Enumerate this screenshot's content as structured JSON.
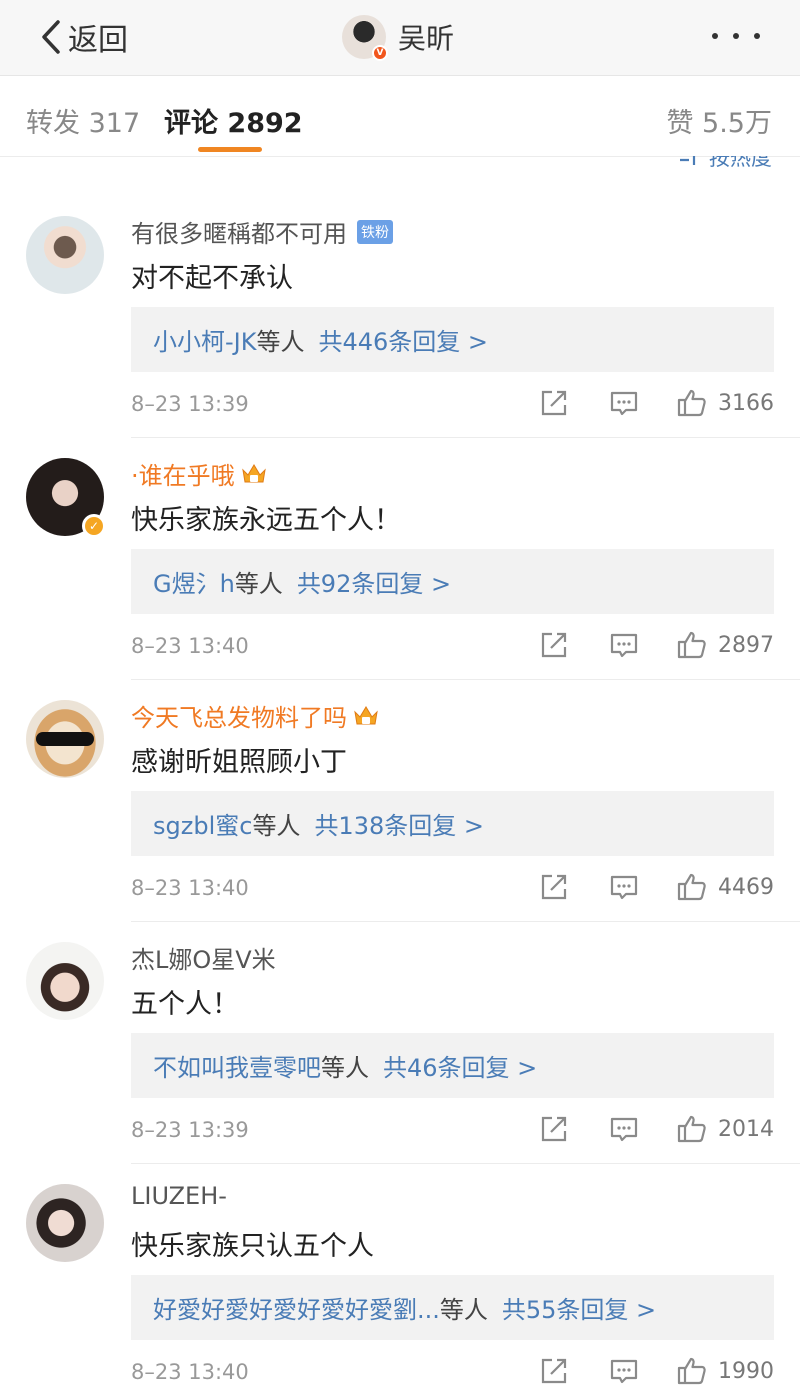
{
  "nav": {
    "back_label": "返回",
    "title": "吴昕",
    "verified_badge": "V"
  },
  "tabs": {
    "repost_label": "转发",
    "repost_count": "317",
    "comment_label": "评论",
    "comment_count": "2892",
    "like_label": "赞",
    "like_count": "5.5万"
  },
  "sort_label": "按热度",
  "comments": [
    {
      "user": "有很多暱稱都不可用",
      "badge": "铁粉",
      "text": "对不起不承认",
      "reply_name": "小小柯-JK",
      "reply_mid": "等人",
      "reply_count": "共446条回复 >",
      "time": "8–23 13:39",
      "likes": "3166"
    },
    {
      "user": "·谁在乎哦",
      "text": "快乐家族永远五个人！",
      "reply_name": "G煜氵h",
      "reply_mid": "等人",
      "reply_count": "共92条回复 >",
      "time": "8–23 13:40",
      "likes": "2897"
    },
    {
      "user": "今天飞总发物料了吗",
      "text": "感谢昕姐照顾小丁",
      "reply_name": "sgzbl蜜c",
      "reply_mid": "等人",
      "reply_count": "共138条回复 >",
      "time": "8–23 13:40",
      "likes": "4469"
    },
    {
      "user": "杰L娜O星V米",
      "text": "五个人！",
      "reply_name": "不如叫我壹零吧",
      "reply_mid": "等人",
      "reply_count": "共46条回复 >",
      "time": "8–23 13:39",
      "likes": "2014"
    },
    {
      "user": "LIUZEH-",
      "text": "快乐家族只认五个人",
      "reply_name": "好愛好愛好愛好愛好愛劉...",
      "reply_mid": "等人",
      "reply_count": "共55条回复 >",
      "time": "8–23 13:40",
      "likes": "1990"
    }
  ],
  "colors": {
    "link": "#4a7cb6",
    "vip_name": "#f07a24",
    "tab_accent": "#f08622"
  }
}
